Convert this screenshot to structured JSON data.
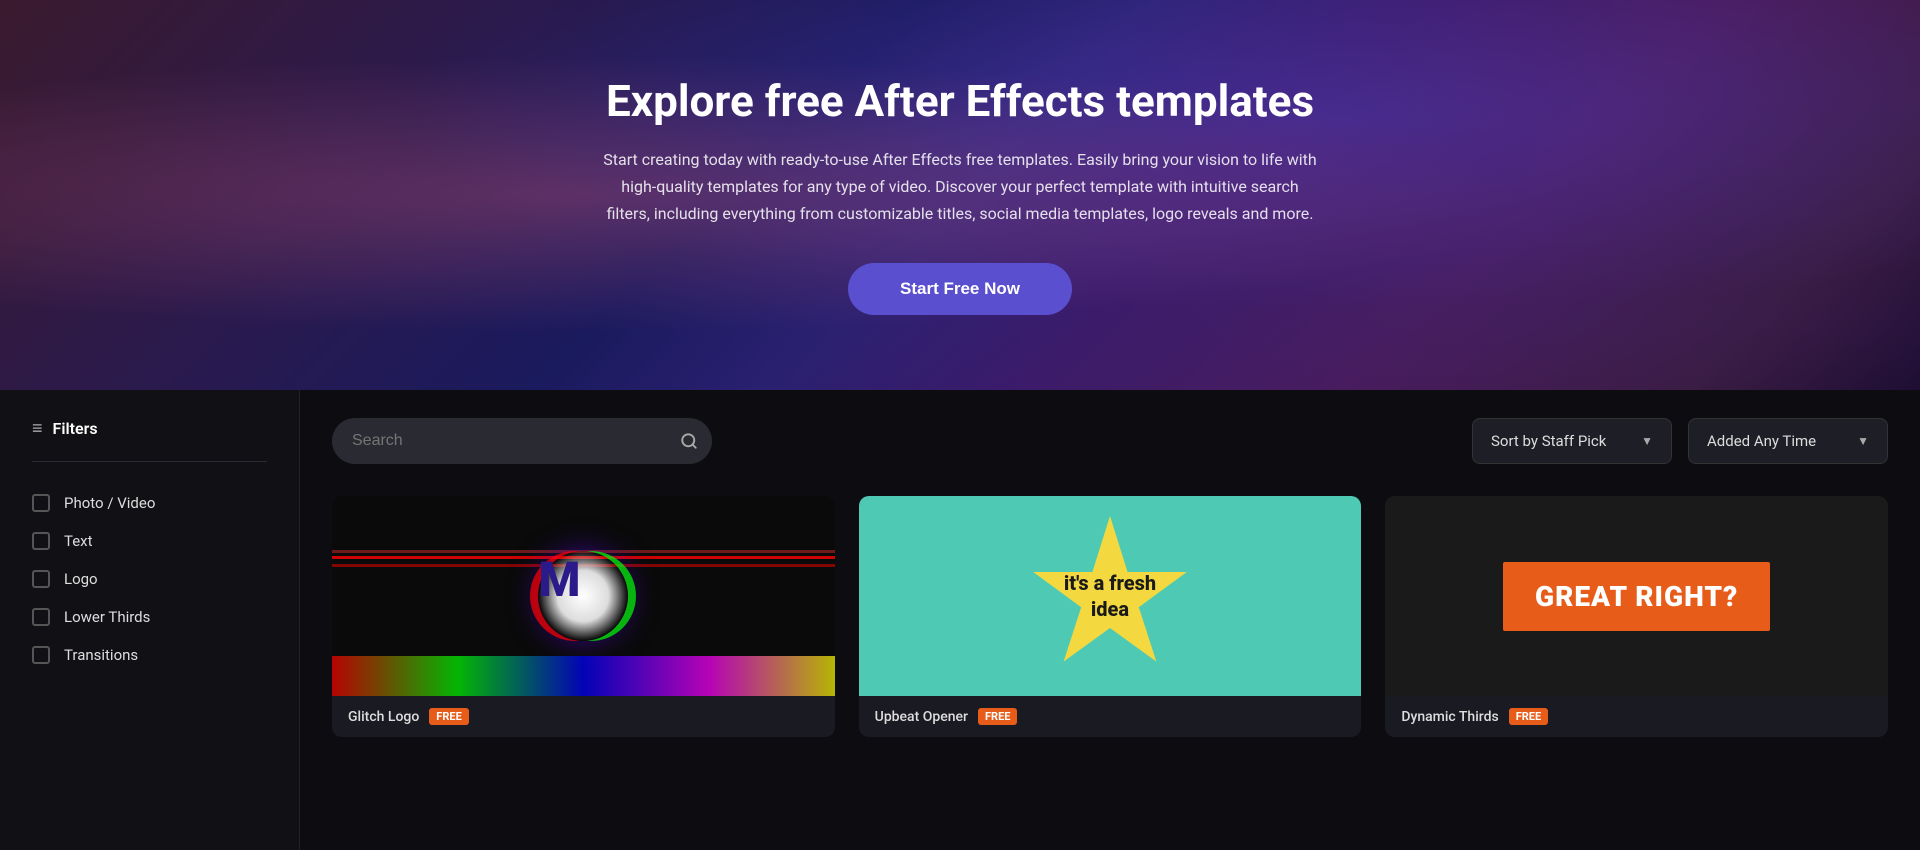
{
  "hero": {
    "title": "Explore free After Effects templates",
    "subtitle": "Start creating today with ready-to-use After Effects free templates. Easily bring your vision to life with high-quality templates for any type of video. Discover your perfect template with intuitive search filters, including everything from customizable titles, social media templates, logo reveals and more.",
    "cta_label": "Start Free Now"
  },
  "sidebar": {
    "filters_label": "Filters",
    "items": [
      {
        "id": "photo-video",
        "label": "Photo / Video"
      },
      {
        "id": "text",
        "label": "Text"
      },
      {
        "id": "logo",
        "label": "Logo"
      },
      {
        "id": "lower-thirds",
        "label": "Lower Thirds"
      },
      {
        "id": "transitions",
        "label": "Transitions"
      }
    ]
  },
  "controls": {
    "search_placeholder": "Search",
    "sort_label": "Sort by Staff Pick",
    "time_label": "Added Any Time"
  },
  "templates": [
    {
      "id": "glitch-logo",
      "name": "Glitch Logo",
      "badge": "FREE",
      "type": "glitch"
    },
    {
      "id": "upbeat-opener",
      "name": "Upbeat Opener",
      "badge": "FREE",
      "type": "upbeat",
      "text_line1": "it's a fresh",
      "text_line2": "idea"
    },
    {
      "id": "dynamic-thirds",
      "name": "Dynamic Thirds",
      "badge": "FREE",
      "type": "dynamic",
      "banner_text": "GREAT RIGHT?"
    }
  ]
}
